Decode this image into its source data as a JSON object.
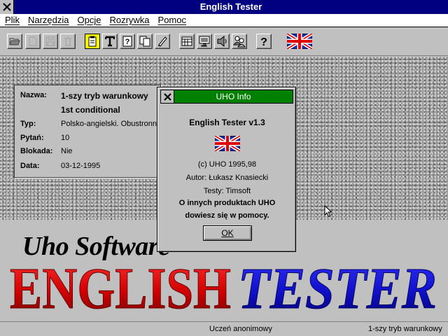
{
  "app": {
    "title": "English Tester"
  },
  "menu": {
    "items": [
      "Plik",
      "Narzędzia",
      "Opcje",
      "Rozrywka",
      "Pomoc"
    ]
  },
  "toolbar": {
    "buttons": [
      {
        "icon": "open-folder-icon",
        "state": "enabled"
      },
      {
        "icon": "new-document-icon",
        "state": "disabled"
      },
      {
        "icon": "save-icon",
        "state": "disabled"
      },
      {
        "icon": "trash-icon",
        "state": "disabled"
      },
      {
        "icon": "clipboard-icon",
        "state": "active"
      },
      {
        "icon": "text-icon",
        "state": "enabled"
      },
      {
        "icon": "question-card-icon",
        "state": "enabled"
      },
      {
        "icon": "copy-pages-icon",
        "state": "enabled"
      },
      {
        "icon": "pen-icon",
        "state": "enabled"
      },
      {
        "icon": "calendar-icon",
        "state": "enabled"
      },
      {
        "icon": "monitor-icon",
        "state": "enabled"
      },
      {
        "icon": "speaker-icon",
        "state": "enabled"
      },
      {
        "icon": "people-icon",
        "state": "enabled"
      },
      {
        "icon": "help-icon",
        "state": "enabled"
      },
      {
        "icon": "uk-flag-icon",
        "state": "enabled"
      }
    ]
  },
  "info": {
    "name_label": "Nazwa:",
    "name_line1": "1-szy tryb warunkowy",
    "name_line2": "1st conditional",
    "type_label": "Typ:",
    "type_value": "Polsko-angielski. Obustronny",
    "questions_label": "Pytań:",
    "questions_value": "10",
    "lock_label": "Blokada:",
    "lock_value": "Nie",
    "date_label": "Data:",
    "date_value": "03-12-1995"
  },
  "dialog": {
    "title": "UHO Info",
    "heading": "English Tester v1.3",
    "copyright": "(c) UHO 1995,98",
    "author": "Autor: Łukasz Knasiecki",
    "tests": "Testy: Timsoft",
    "more_line1": "O innych produktach UHO",
    "more_line2": "dowiesz się w pomocy.",
    "ok_label": "OK"
  },
  "logo": {
    "company": "Uho Software",
    "word1": "ENGLISH",
    "word2": "TESTER",
    "color1": "#e00000",
    "color2": "#1010d0"
  },
  "status": {
    "user": "Uczeń anonimowy",
    "mode": "1-szy tryb warunkowy"
  },
  "colors": {
    "titlebar": "#000080",
    "dialog_titlebar": "#008000",
    "active_tool": "#ffff00"
  }
}
